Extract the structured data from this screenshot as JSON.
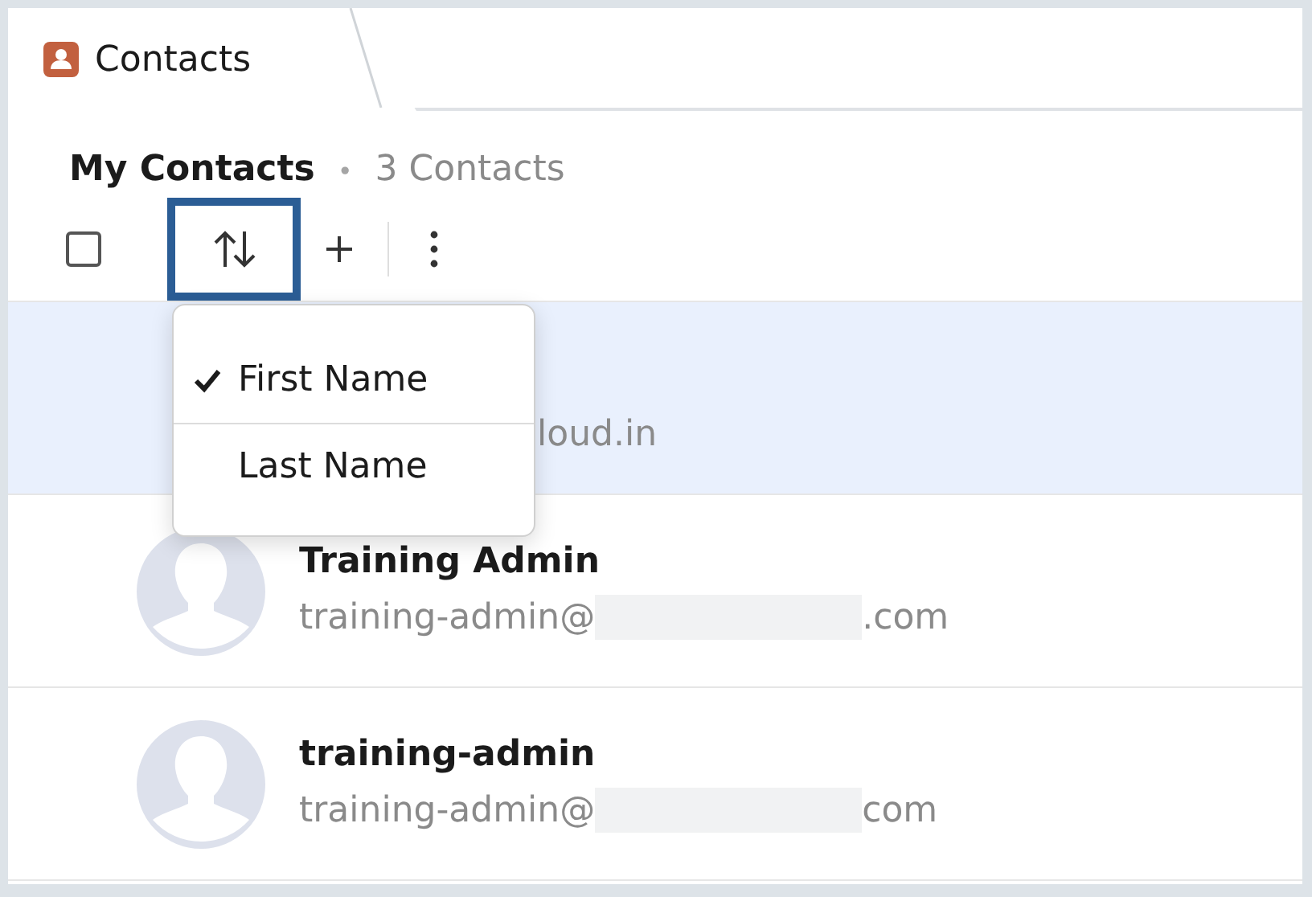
{
  "tab": {
    "title": "Contacts",
    "selected": true
  },
  "header": {
    "title": "My Contacts",
    "separator": "•",
    "count": "3 Contacts"
  },
  "toolbar": {
    "select_all_checked": false,
    "sort_focused": true
  },
  "sort_menu": [
    {
      "label": "First Name",
      "checked": true
    },
    {
      "label": "Last Name",
      "checked": false
    }
  ],
  "contacts": [
    {
      "selected": true,
      "covered": true,
      "email_parts": [
        "loud.in"
      ]
    },
    {
      "selected": false,
      "covered": false,
      "name": "Training Admin",
      "email_parts": [
        "training-admin@",
        ".com"
      ]
    },
    {
      "selected": false,
      "covered": false,
      "name": "training-admin",
      "email_parts": [
        "training-admin@",
        "com"
      ]
    }
  ]
}
